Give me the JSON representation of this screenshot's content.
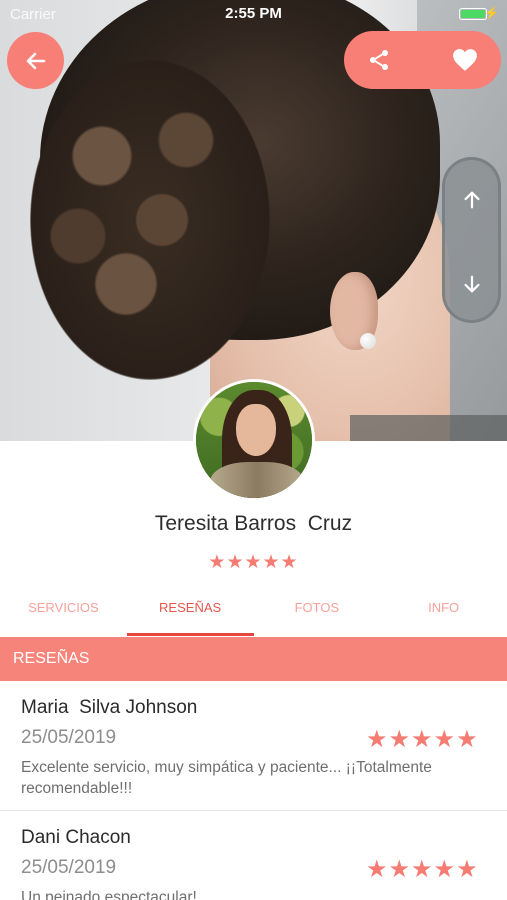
{
  "status_bar": {
    "carrier": "Carrier",
    "time": "2:55 PM"
  },
  "colors": {
    "accent": "#f77f75",
    "tab_active": "#e4574d",
    "star": "#f47c73"
  },
  "icons": {
    "back": "arrow-left-icon",
    "share": "share-icon",
    "favorite": "heart-icon",
    "scroll_up": "arrow-up-icon",
    "scroll_down": "arrow-down-icon"
  },
  "profile": {
    "name": "Teresita Barros  Cruz",
    "rating_stars": "★★★★★",
    "rating": 5
  },
  "tabs": [
    {
      "label": "SERVICIOS",
      "active": false
    },
    {
      "label": "RESEÑAS",
      "active": true
    },
    {
      "label": "FOTOS",
      "active": false
    },
    {
      "label": "INFO",
      "active": false
    }
  ],
  "section": {
    "title": "RESEÑAS"
  },
  "reviews": [
    {
      "author": "Maria  Silva Johnson",
      "date": "25/05/2019",
      "stars": "★★★★★",
      "rating": 5,
      "text": "Excelente servicio, muy simpática y paciente... ¡¡Totalmente recomendable!!!"
    },
    {
      "author": "Dani Chacon",
      "date": "25/05/2019",
      "stars": "★★★★★",
      "rating": 5,
      "text": "Un peinado espectacular!"
    }
  ]
}
